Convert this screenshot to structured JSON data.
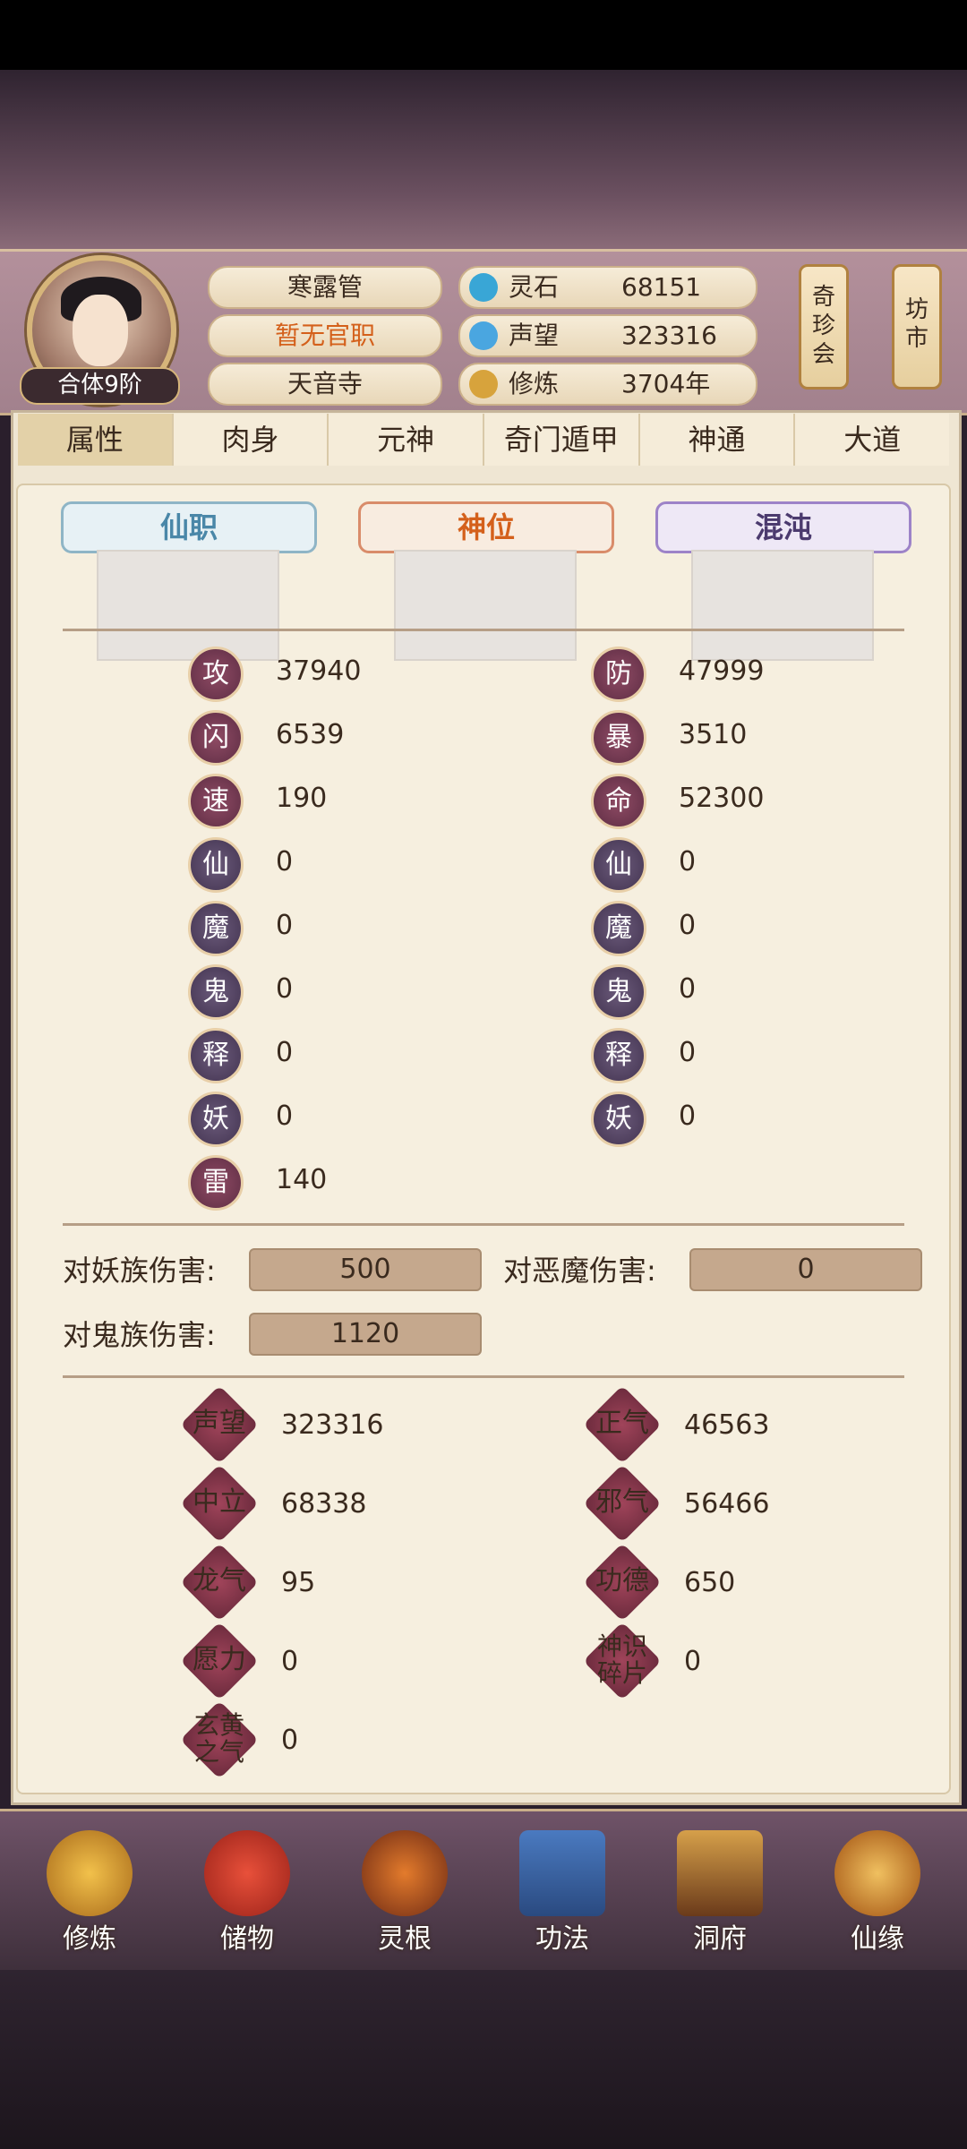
{
  "header": {
    "rank_badge": "合体9阶",
    "titles": [
      "寒露管",
      "暂无官职",
      "天音寺"
    ],
    "resources": [
      {
        "label": "灵石",
        "value": "68151",
        "icon": "spirit-stone-icon"
      },
      {
        "label": "声望",
        "value": "323316",
        "icon": "reputation-icon"
      },
      {
        "label": "修炼",
        "value": "3704年",
        "icon": "meditation-icon"
      }
    ],
    "side_scrolls": [
      "奇珍会",
      "坊市"
    ]
  },
  "tabs": [
    "属性",
    "肉身",
    "元神",
    "奇门遁甲",
    "神通",
    "大道"
  ],
  "positions": {
    "xianzhi": "仙职",
    "shenwei": "神位",
    "hundun": "混沌"
  },
  "stats_left": [
    {
      "icon": "攻",
      "value": "37940"
    },
    {
      "icon": "闪",
      "value": "6539"
    },
    {
      "icon": "速",
      "value": "190"
    },
    {
      "icon": "仙",
      "value": "0"
    },
    {
      "icon": "魔",
      "value": "0"
    },
    {
      "icon": "鬼",
      "value": "0"
    },
    {
      "icon": "释",
      "value": "0"
    },
    {
      "icon": "妖",
      "value": "0"
    },
    {
      "icon": "雷",
      "value": "140"
    }
  ],
  "stats_right": [
    {
      "icon": "防",
      "value": "47999"
    },
    {
      "icon": "暴",
      "value": "3510"
    },
    {
      "icon": "命",
      "value": "52300"
    },
    {
      "icon": "仙",
      "value": "0"
    },
    {
      "icon": "魔",
      "value": "0"
    },
    {
      "icon": "鬼",
      "value": "0"
    },
    {
      "icon": "释",
      "value": "0"
    },
    {
      "icon": "妖",
      "value": "0"
    }
  ],
  "damage": {
    "yao_label": "对妖族伤害:",
    "yao_value": "500",
    "emo_label": "对恶魔伤害:",
    "emo_value": "0",
    "gui_label": "对鬼族伤害:",
    "gui_value": "1120"
  },
  "extra_left": [
    {
      "label": "声望",
      "value": "323316"
    },
    {
      "label": "中立",
      "value": "68338"
    },
    {
      "label": "龙气",
      "value": "95"
    },
    {
      "label": "愿力",
      "value": "0"
    },
    {
      "label": "玄黄之气",
      "value": "0"
    }
  ],
  "extra_right": [
    {
      "label": "正气",
      "value": "46563"
    },
    {
      "label": "邪气",
      "value": "56466"
    },
    {
      "label": "功德",
      "value": "650"
    },
    {
      "label": "神识碎片",
      "value": "0"
    }
  ],
  "bottom_nav": [
    {
      "label": "修炼",
      "icon": "monk-icon"
    },
    {
      "label": "储物",
      "icon": "bag-icon"
    },
    {
      "label": "灵根",
      "icon": "spirit-root-icon"
    },
    {
      "label": "功法",
      "icon": "book-icon"
    },
    {
      "label": "洞府",
      "icon": "cave-house-icon"
    },
    {
      "label": "仙缘",
      "icon": "gourd-icon"
    }
  ]
}
